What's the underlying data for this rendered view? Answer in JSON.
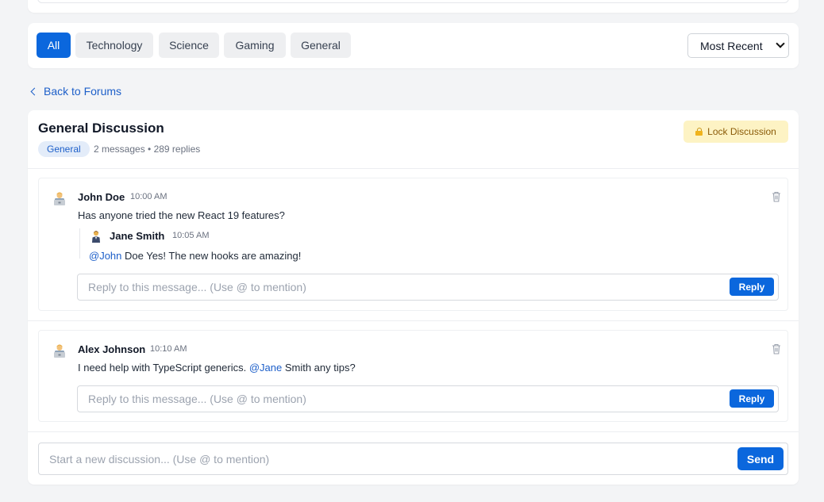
{
  "filters": {
    "chips": [
      {
        "label": "All"
      },
      {
        "label": "Technology"
      },
      {
        "label": "Science"
      },
      {
        "label": "Gaming"
      },
      {
        "label": "General"
      }
    ],
    "sort_selected": "Most Recent"
  },
  "back_link": "Back to Forums",
  "discussion": {
    "title": "General Discussion",
    "tag": "General",
    "meta": "2 messages • 289 replies",
    "lock_label": "Lock Discussion",
    "messages": [
      {
        "author": "John Doe",
        "time": "10:00 AM",
        "text": "Has anyone tried the new React 19 features?",
        "reply": {
          "author": "Jane Smith",
          "time": "10:05 AM",
          "mention": "@John",
          "text": " Doe Yes! The new hooks are amazing!"
        },
        "reply_placeholder": "Reply to this message... (Use @ to mention)",
        "reply_button": "Reply"
      },
      {
        "author": "Alex Johnson",
        "time": "10:10 AM",
        "text_before": "I need help with TypeScript generics. ",
        "mention": "@Jane",
        "text_after": " Smith any tips?",
        "reply_placeholder": "Reply to this message... (Use @ to mention)",
        "reply_button": "Reply"
      }
    ],
    "new_placeholder": "Start a new discussion... (Use @ to mention)",
    "send_label": "Send"
  },
  "colors": {
    "accent": "#0b67dd",
    "mention": "#1d5fc9",
    "lock_bg": "#fdf3c4",
    "page_bg": "#f3f4f6"
  }
}
